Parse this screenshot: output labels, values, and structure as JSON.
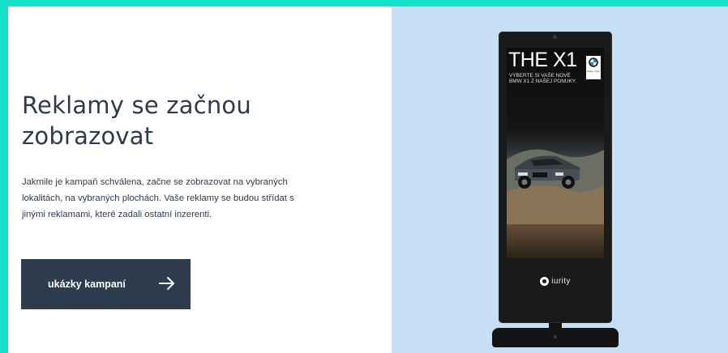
{
  "section": {
    "headline": "Reklamy se začnou zobrazovat",
    "body": "Jakmile je kampaň schválena, začne se zobrazovat na vybraných lokalitách, na vybraných plochách. Vaše reklamy se budou střídat s jinými reklamami, které zadali ostatní inzerenti.",
    "cta_label": "ukázky kampaní",
    "cta_icon": "arrow-right-icon"
  },
  "kiosk": {
    "ad_title": "THE X1",
    "ad_subtitle": "VYBERTE SI VAŠE NOVÉ BMW X1 Z NAŠEJ PONUKY.",
    "ad_brand_caption": "Radost z jízdy",
    "screen_brand": "iurity",
    "brand_logo_icon": "bmw-logo-icon",
    "screen_brand_icon": "iurity-logo-icon"
  },
  "colors": {
    "frame_accent": "#13e0c8",
    "text_dark": "#2d3b4c",
    "button_bg": "#2e3c4d",
    "panel_bg": "#c7dff5",
    "kiosk_body": "#1a1a1a"
  }
}
